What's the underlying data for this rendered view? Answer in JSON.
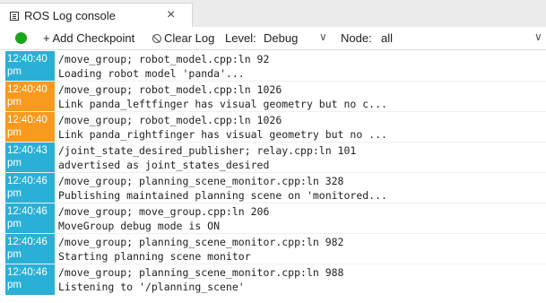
{
  "tab": {
    "title": "ROS Log console",
    "close": "×"
  },
  "toolbar": {
    "add_checkpoint": "+ Add Checkpoint",
    "clear_log": "Clear Log",
    "level_label": "Level:",
    "level_value": "Debug",
    "node_label": "Node:",
    "node_value": "all",
    "chevron": "∨",
    "status_color": "#19a61b"
  },
  "colors": {
    "info": "#2ab0d6",
    "warn": "#f79a1e"
  },
  "entries": [
    {
      "time": "12:40:40",
      "ampm": "pm",
      "level": "info",
      "source": "/move_group; robot_model.cpp:ln 92",
      "message": "Loading robot model 'panda'..."
    },
    {
      "time": "12:40:40",
      "ampm": "pm",
      "level": "warn",
      "source": "/move_group; robot_model.cpp:ln 1026",
      "message": "Link panda_leftfinger has visual geometry but no c..."
    },
    {
      "time": "12:40:40",
      "ampm": "pm",
      "level": "warn",
      "source": "/move_group; robot_model.cpp:ln 1026",
      "message": "Link panda_rightfinger has visual geometry but no ..."
    },
    {
      "time": "12:40:43",
      "ampm": "pm",
      "level": "info",
      "source": "/joint_state_desired_publisher; relay.cpp:ln 101",
      "message": "advertised as joint_states_desired"
    },
    {
      "time": "12:40:46",
      "ampm": "pm",
      "level": "info",
      "source": "/move_group; planning_scene_monitor.cpp:ln 328",
      "message": "Publishing maintained planning scene on 'monitored..."
    },
    {
      "time": "12:40:46",
      "ampm": "pm",
      "level": "info",
      "source": "/move_group; move_group.cpp:ln 206",
      "message": "MoveGroup debug mode is ON"
    },
    {
      "time": "12:40:46",
      "ampm": "pm",
      "level": "info",
      "source": "/move_group; planning_scene_monitor.cpp:ln 982",
      "message": "Starting planning scene monitor"
    },
    {
      "time": "12:40:46",
      "ampm": "pm",
      "level": "info",
      "source": "/move_group; planning_scene_monitor.cpp:ln 988",
      "message": "Listening to '/planning_scene'"
    }
  ]
}
